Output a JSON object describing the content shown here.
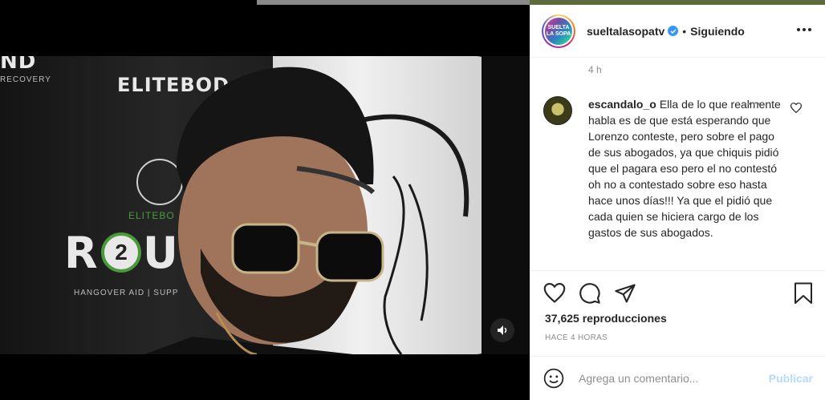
{
  "post": {
    "username": "sueltalasopatv",
    "separator": "•",
    "follow_status": "Siguiendo",
    "avatar_text": "SUELTA LA SOPA",
    "time_ago_short": "4 h"
  },
  "video": {
    "banner": {
      "elite_body": "ELITEBOD",
      "recovery": "RECOVERY",
      "elite_body_small": "ELITEBO",
      "round": "R",
      "round_number": "2",
      "round_rest": "UN",
      "hangover": "HANGOVER AID | SUPP",
      "nd": "ND"
    },
    "mute_icon": "speaker-icon"
  },
  "comment": {
    "username": "escandalo_o",
    "text": "Ella de lo que realmente habla es de que está esperando que Lorenzo conteste, pero sobre el pago de sus abogados, ya que chiquis pidió que el pagara eso pero el no contestó oh no a contestado sobre eso hasta hace unos días!!! Ya que el pidió que cada quien se hiciera cargo de los gastos de sus abogados."
  },
  "actions": {
    "views": "37,625 reproducciones",
    "posted": "HACE 4 HORAS",
    "icons": [
      "heart-icon",
      "comment-icon",
      "share-icon",
      "bookmark-icon"
    ]
  },
  "composer": {
    "placeholder": "Agrega un comentario...",
    "publish_label": "Publicar",
    "emoji_icon": "smiley-icon"
  },
  "colors": {
    "verified": "#3897f0",
    "publish_disabled": "#b3dbff",
    "text_primary": "#262626",
    "text_secondary": "#8e8e8e"
  }
}
